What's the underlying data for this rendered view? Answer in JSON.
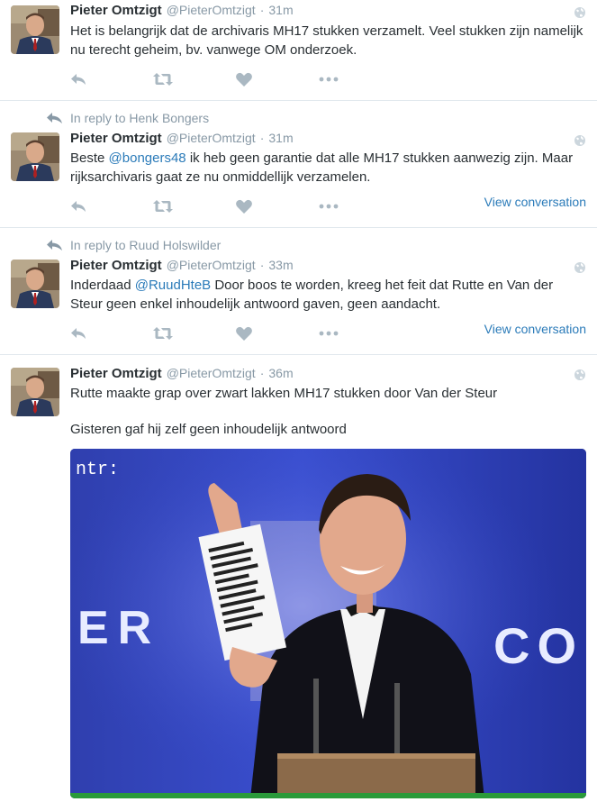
{
  "colors": {
    "text": "#292f33",
    "muted": "#8899a6",
    "link": "#2b7bb9",
    "divider": "#e1e8ed"
  },
  "icons": {
    "reply": "reply-icon",
    "retweet": "retweet-icon",
    "like": "heart-icon",
    "more": "more-dots-icon",
    "globe": "globe-icon",
    "in_reply": "reply-arrow-icon"
  },
  "tweets": [
    {
      "name": "Pieter Omtzigt",
      "handle": "@PieterOmtzigt",
      "separator": "·",
      "time": "31m",
      "text": "Het is belangrijk dat de archivaris MH17 stukken verzamelt. Veel stukken zijn namelijk nu terecht geheim, bv. vanwege OM onderzoek."
    },
    {
      "in_reply_to": "In reply to Henk Bongers",
      "name": "Pieter Omtzigt",
      "handle": "@PieterOmtzigt",
      "separator": "·",
      "time": "31m",
      "text_before": "Beste ",
      "mention": "@bongers48",
      "text_after": " ik heb geen garantie dat alle MH17 stukken aanwezig zijn. Maar rijksarchivaris gaat ze nu onmiddellijk verzamelen.",
      "view_conversation": "View conversation"
    },
    {
      "in_reply_to": "In reply to Ruud Holswilder",
      "name": "Pieter Omtzigt",
      "handle": "@PieterOmtzigt",
      "separator": "·",
      "time": "33m",
      "text_before": "Inderdaad ",
      "mention": "@RuudHteB",
      "text_after": " Door boos te worden, kreeg het feit dat Rutte en Van der Steur geen enkel inhoudelijk antwoord gaven, geen aandacht.",
      "view_conversation": "View conversation"
    },
    {
      "name": "Pieter Omtzigt",
      "handle": "@PieterOmtzigt",
      "separator": "·",
      "time": "36m",
      "text_line1": "Rutte maakte grap over zwart lakken MH17 stukken door Van der Steur",
      "text_line2": "Gisteren gaf hij zelf geen inhoudelijk antwoord",
      "media_watermark": "ntr:",
      "media_backdrop_left": "ER",
      "media_backdrop_right": "CO"
    }
  ]
}
